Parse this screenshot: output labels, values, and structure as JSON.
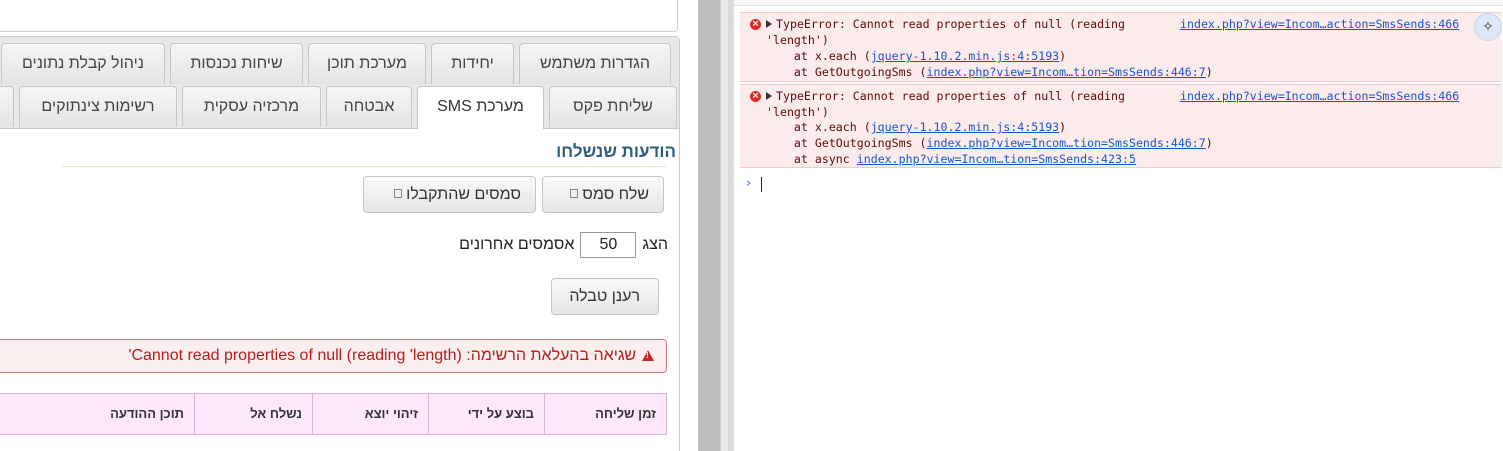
{
  "tabs_row1": [
    {
      "label": "הגדרות משתמש"
    },
    {
      "label": "יחידות"
    },
    {
      "label": "מערכת תוכן"
    },
    {
      "label": "שיחות נכנסות"
    },
    {
      "label": "ניהול קבלת נתונים"
    }
  ],
  "tabs_row2": [
    {
      "label": "שליחת פקס"
    },
    {
      "label": "מערכת SMS",
      "active": true
    },
    {
      "label": "אבטחה"
    },
    {
      "label": "מרכזיה עסקית"
    },
    {
      "label": "רשימות צינתוקים"
    }
  ],
  "section": {
    "title": "הודעות שנשלחו"
  },
  "buttons": {
    "send_sms": "שלח סמס",
    "received_sms": "סמסים שהתקבלו",
    "refresh_table": "רענן טבלה"
  },
  "show_row": {
    "prefix": "הצג",
    "count": "50",
    "suffix": "אסמסים אחרונים"
  },
  "error": {
    "text": "שגיאה בהעלאת הרשימה: (Cannot read properties of null (reading 'length'"
  },
  "table": {
    "columns": [
      "זמן שליחה",
      "בוצע על ידי",
      "זיהוי יוצא",
      "נשלח אל",
      "תוכן ההודעה"
    ]
  },
  "console": {
    "messages": [
      {
        "head": "TypeError: Cannot read properties of null (reading",
        "head2": "'length')",
        "source": "index.php?view=Incom…action=SmsSends:466",
        "stack": [
          {
            "prefix": "    at x.each (",
            "link": "jquery-1.10.2.min.js:4:5193",
            "suffix": ")"
          },
          {
            "prefix": "    at GetOutgoingSms (",
            "link": "index.php?view=Incom…tion=SmsSends:446:7",
            "suffix": ")"
          }
        ]
      },
      {
        "head": "TypeError: Cannot read properties of null (reading",
        "head2": "'length')",
        "source": "index.php?view=Incom…action=SmsSends:466",
        "stack": [
          {
            "prefix": "    at x.each (",
            "link": "jquery-1.10.2.min.js:4:5193",
            "suffix": ")"
          },
          {
            "prefix": "    at GetOutgoingSms (",
            "link": "index.php?view=Incom…tion=SmsSends:446:7",
            "suffix": ")"
          },
          {
            "prefix": "    at async ",
            "link": "index.php?view=Incom…tion=SmsSends:423:5",
            "suffix": ""
          }
        ]
      }
    ],
    "prompt_symbol": "›",
    "error_icon": "error-circle-icon",
    "ai_icon": "ai-assistant-icon"
  }
}
